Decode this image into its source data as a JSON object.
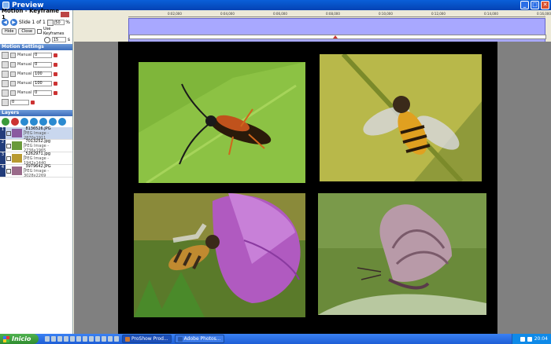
{
  "window": {
    "title": "Preview"
  },
  "left": {
    "keyframe_title": "Motion - Keyframe 1",
    "slide": "Slide 1 of 1",
    "zoom": "50",
    "zoom_unit": "%",
    "hide": "Hide",
    "close": "Close",
    "use_keyframes": "Use Keyframes",
    "time": "15",
    "time_unit": "s",
    "motion_settings": "Motion Settings",
    "ms_rows": [
      {
        "mode": "Manual",
        "value": "0"
      },
      {
        "mode": "Manual",
        "value": "0"
      },
      {
        "mode": "Manual",
        "value": "100"
      },
      {
        "mode": "Manual",
        "value": "100"
      },
      {
        "mode": "Manual",
        "value": "0"
      },
      {
        "mode": "",
        "value": "0"
      }
    ],
    "layers_title": "Layers",
    "layers": [
      {
        "num": "1",
        "name": "_8136526.JPG",
        "info": "JPEG Image - 2870x1911",
        "selected": true,
        "color": "#8a5aa0"
      },
      {
        "num": "2",
        "name": "_7013252.jpg",
        "info": "JPEG Image - 2736x1965",
        "selected": false,
        "color": "#6a9a3a"
      },
      {
        "num": "3",
        "name": "_5262971.jpg",
        "info": "JPEG Image - 1942x1440",
        "selected": false,
        "color": "#b89a30"
      },
      {
        "num": "4",
        "name": "_3979642.JPG",
        "info": "JPEG Image - 3028x2269",
        "selected": false,
        "color": "#9a6a8a"
      }
    ]
  },
  "timeline": {
    "ticks": [
      "0:02,000",
      "0:04,000",
      "0:06,000",
      "0:08,000",
      "0:10,000",
      "0:12,000",
      "0:14,000",
      "0:16,000"
    ]
  },
  "taskbar": {
    "start": "Inicio",
    "tasks": [
      "ProShow Prod...",
      "Adobe Photos..."
    ],
    "clock": "20:04"
  }
}
